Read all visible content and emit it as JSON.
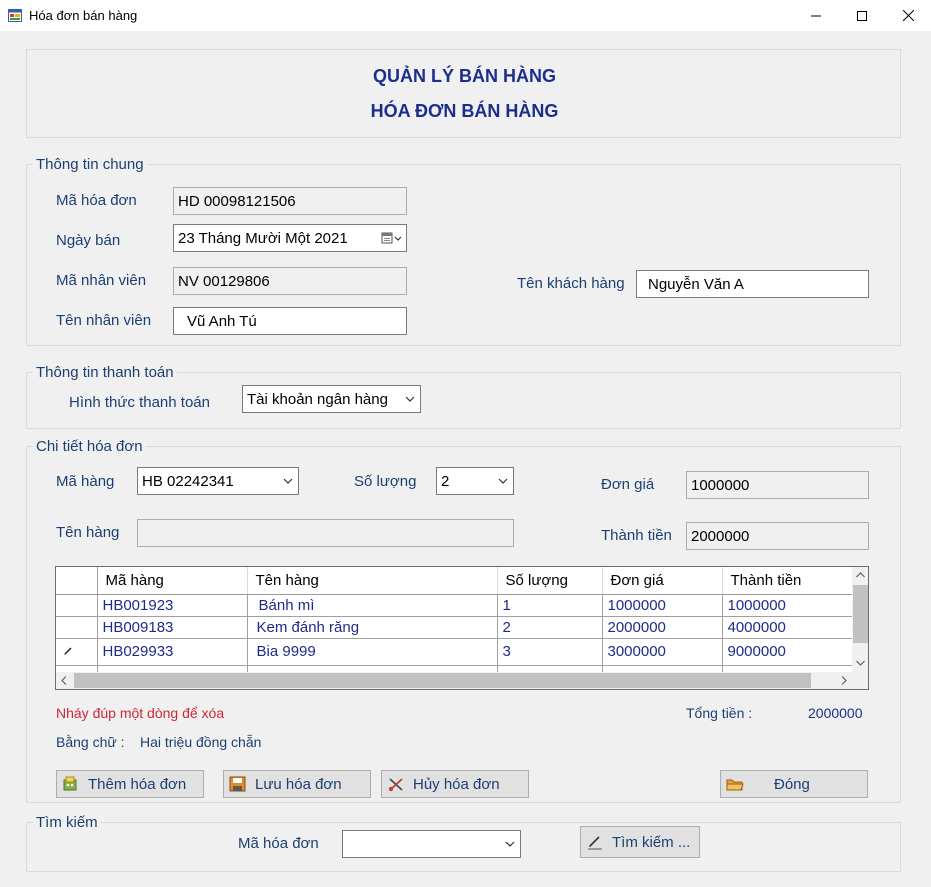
{
  "window": {
    "title": "Hóa đơn bán hàng"
  },
  "header": {
    "line1": "QUẢN LÝ BÁN HÀNG",
    "line2": "HÓA ĐƠN BÁN HÀNG"
  },
  "general": {
    "caption": "Thông tin chung",
    "invoice_id_label": "Mã hóa đơn",
    "invoice_id": "HD 00098121506",
    "sale_date_label": "Ngày bán",
    "sale_date": "23 Tháng Mười Một 2021",
    "employee_id_label": "Mã nhân viên",
    "employee_id": "NV 00129806",
    "employee_name_label": "Tên nhân viên",
    "employee_name": "Vũ Anh Tú",
    "customer_name_label": "Tên khách hàng",
    "customer_name": "Nguyễn Văn A"
  },
  "payment": {
    "caption": "Thông tin thanh toán",
    "method_label": "Hình thức thanh toán",
    "method": "Tài khoản ngân hàng"
  },
  "detail": {
    "caption": "Chi tiết hóa đơn",
    "item_code_label": "Mã hàng",
    "item_code": "HB 02242341",
    "quantity_label": "Số lượng",
    "quantity": "2",
    "unit_price_label": "Đơn giá",
    "unit_price": "1000000",
    "item_name_label": "Tên hàng",
    "item_name": "",
    "amount_label": "Thành tiền",
    "amount": "2000000"
  },
  "grid": {
    "columns": [
      "Mã hàng",
      "Tên hàng",
      "Số lượng",
      "Đơn giá",
      "Thành tiền"
    ],
    "rows": [
      [
        "HB001923",
        "Bánh mì",
        "1",
        "1000000",
        "1000000"
      ],
      [
        "HB009183",
        "Kem đánh răng",
        "2",
        "2000000",
        "4000000"
      ],
      [
        "HB029933",
        "Bia 9999",
        "3",
        "3000000",
        "9000000"
      ]
    ]
  },
  "summary": {
    "hint": "Nháy đúp một dòng để xóa",
    "total_label": "Tổng tiền :",
    "total": "2000000",
    "words_label": "Bằng chữ :",
    "words": "Hai triệu đồng chẵn"
  },
  "buttons": {
    "add": "Thêm hóa đơn",
    "save": "Lưu hóa đơn",
    "cancel": "Hủy hóa đơn",
    "close": "Đóng"
  },
  "search": {
    "caption": "Tìm kiếm",
    "invoice_label": "Mã hóa đơn",
    "invoice_value": "",
    "button": "Tìm kiếm ..."
  },
  "colors": {
    "label": "#1a3f73",
    "header": "#1b2e8c",
    "hint": "#d0263a",
    "grid_text": "#1f2a8a"
  },
  "icons": [
    "app-form-icon",
    "minimize-icon",
    "maximize-icon",
    "close-icon",
    "calendar-icon",
    "chevron-down-icon",
    "row-pencil-icon",
    "add-invoice-icon",
    "save-icon",
    "cancel-icon",
    "folder-icon",
    "pencil-search-icon"
  ]
}
